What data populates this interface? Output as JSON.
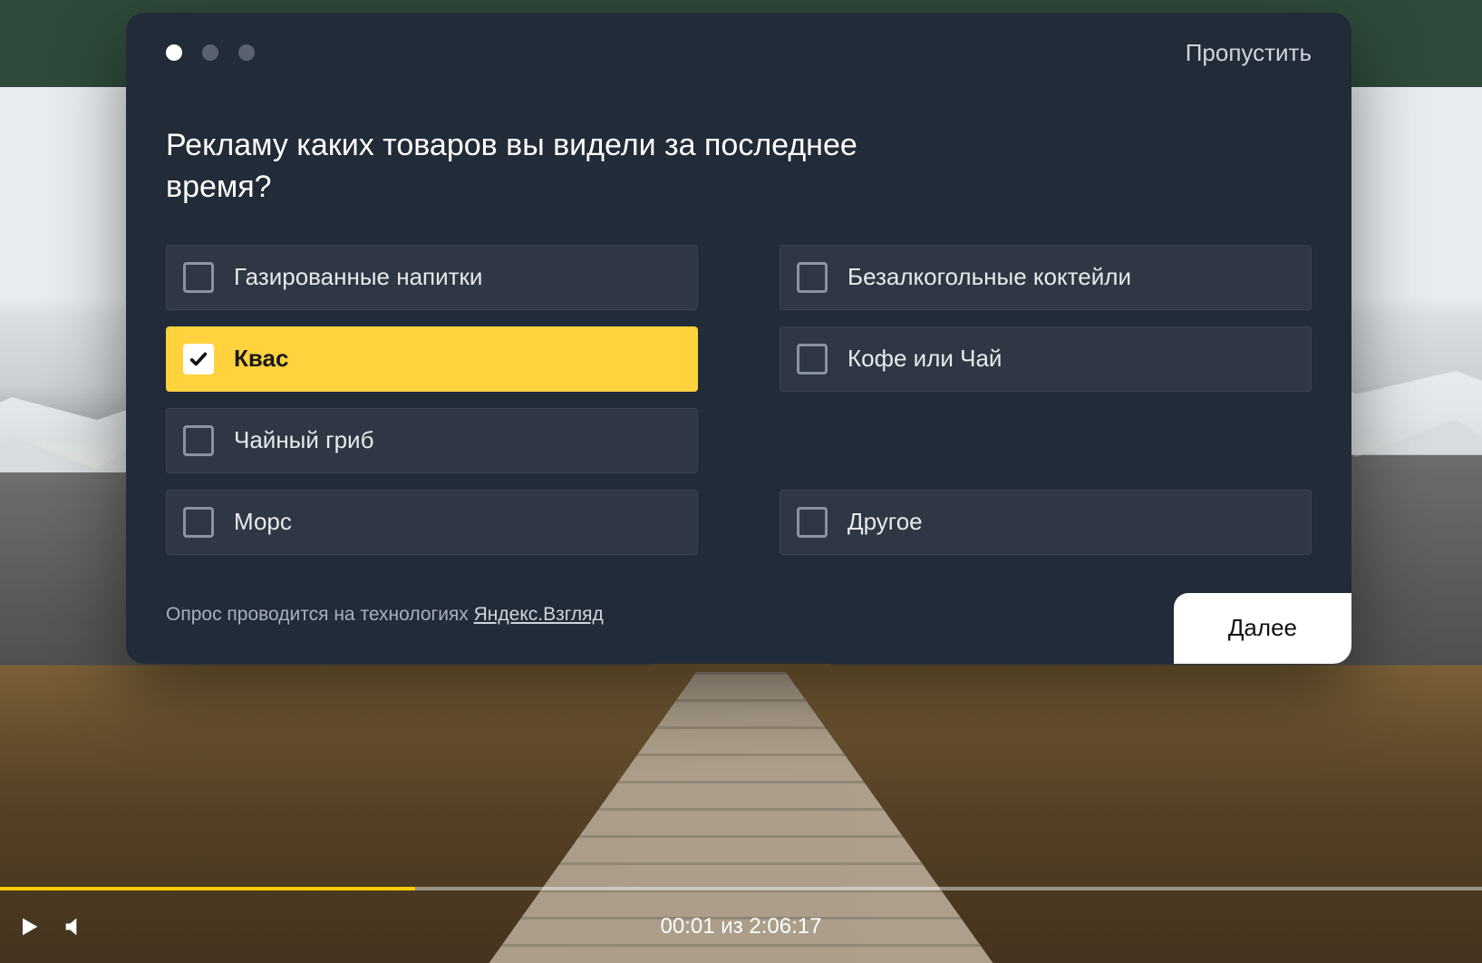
{
  "player": {
    "time_current": "00:01",
    "time_separator": "из",
    "time_total": "2:06:17",
    "progress_percent": 28
  },
  "survey": {
    "skip_label": "Пропустить",
    "step_index": 0,
    "step_count": 3,
    "question": "Рекламу каких товаров вы видели за последнее время?",
    "options_left": [
      {
        "label": "Газированные напитки",
        "checked": false
      },
      {
        "label": "Квас",
        "checked": true
      },
      {
        "label": "Чайный гриб",
        "checked": false
      },
      {
        "label": "Морс",
        "checked": false
      }
    ],
    "options_right": [
      {
        "label": "Безалкогольные коктейли",
        "checked": false
      },
      {
        "label": "Кофе или Чай",
        "checked": false
      },
      {
        "label": "Другое",
        "checked": false
      }
    ],
    "attribution_prefix": "Опрос проводится на технологиях ",
    "attribution_brand": "Яндекс.Взгляд",
    "next_label": "Далее"
  }
}
